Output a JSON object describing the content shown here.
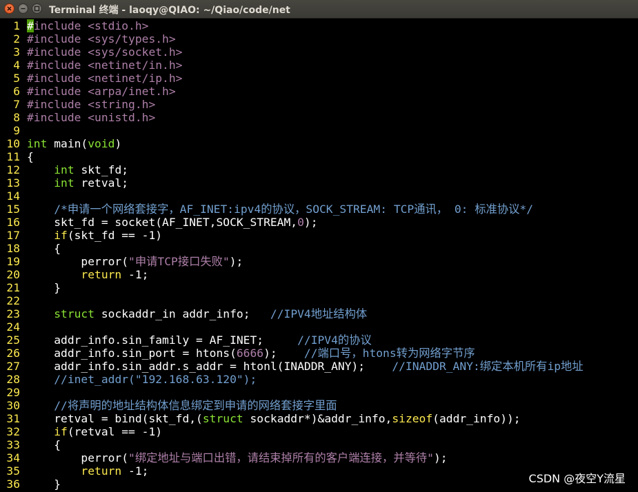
{
  "window": {
    "title": "Terminal 终端 - laoqy@QIAO: ~/Qiao/code/net"
  },
  "colors": {
    "background": "#000000",
    "line_number": "#fce94f",
    "preprocessor": "#ad7fa8",
    "type": "#8ae234",
    "string": "#ad7fa8",
    "comment": "#729fcf",
    "keyword": "#fce94f",
    "text": "#ffffff",
    "cursor": "#4e9a06"
  },
  "editor": {
    "lines": [
      {
        "num": "1",
        "tokens": [
          {
            "t": "#",
            "c": "cur"
          },
          {
            "t": "include ",
            "c": "pp"
          },
          {
            "t": "<stdio.h>",
            "c": "st"
          }
        ]
      },
      {
        "num": "2",
        "tokens": [
          {
            "t": "#include ",
            "c": "pp"
          },
          {
            "t": "<sys/types.h>",
            "c": "st"
          }
        ]
      },
      {
        "num": "3",
        "tokens": [
          {
            "t": "#include ",
            "c": "pp"
          },
          {
            "t": "<sys/socket.h>",
            "c": "st"
          }
        ]
      },
      {
        "num": "4",
        "tokens": [
          {
            "t": "#include ",
            "c": "pp"
          },
          {
            "t": "<netinet/in.h>",
            "c": "st"
          }
        ]
      },
      {
        "num": "5",
        "tokens": [
          {
            "t": "#include ",
            "c": "pp"
          },
          {
            "t": "<netinet/ip.h>",
            "c": "st"
          }
        ]
      },
      {
        "num": "6",
        "tokens": [
          {
            "t": "#include ",
            "c": "pp"
          },
          {
            "t": "<arpa/inet.h>",
            "c": "st"
          }
        ]
      },
      {
        "num": "7",
        "tokens": [
          {
            "t": "#include ",
            "c": "pp"
          },
          {
            "t": "<string.h>",
            "c": "st"
          }
        ]
      },
      {
        "num": "8",
        "tokens": [
          {
            "t": "#include ",
            "c": "pp"
          },
          {
            "t": "<unistd.h>",
            "c": "st"
          }
        ]
      },
      {
        "num": "9",
        "tokens": []
      },
      {
        "num": "10",
        "tokens": [
          {
            "t": "int",
            "c": "ty"
          },
          {
            "t": " main(",
            "c": "tx"
          },
          {
            "t": "void",
            "c": "ty"
          },
          {
            "t": ")",
            "c": "tx"
          }
        ]
      },
      {
        "num": "11",
        "tokens": [
          {
            "t": "{",
            "c": "tx"
          }
        ]
      },
      {
        "num": "12",
        "tokens": [
          {
            "t": "    ",
            "c": "tx"
          },
          {
            "t": "int",
            "c": "ty"
          },
          {
            "t": " skt_fd;",
            "c": "tx"
          }
        ]
      },
      {
        "num": "13",
        "tokens": [
          {
            "t": "    ",
            "c": "tx"
          },
          {
            "t": "int",
            "c": "ty"
          },
          {
            "t": " retval;",
            "c": "tx"
          }
        ]
      },
      {
        "num": "14",
        "tokens": []
      },
      {
        "num": "15",
        "tokens": [
          {
            "t": "    ",
            "c": "tx"
          },
          {
            "t": "/*申请一个网络套接字，AF_INET:ipv4的协议，SOCK_STREAM: TCP通讯， 0: 标准协议*/",
            "c": "cm"
          }
        ]
      },
      {
        "num": "16",
        "tokens": [
          {
            "t": "    skt_fd = socket(AF_INET,SOCK_STREAM,",
            "c": "tx"
          },
          {
            "t": "0",
            "c": "nm"
          },
          {
            "t": ");",
            "c": "tx"
          }
        ]
      },
      {
        "num": "17",
        "tokens": [
          {
            "t": "    ",
            "c": "tx"
          },
          {
            "t": "if",
            "c": "kw"
          },
          {
            "t": "(skt_fd == -1)",
            "c": "tx"
          }
        ]
      },
      {
        "num": "18",
        "tokens": [
          {
            "t": "    {",
            "c": "tx"
          }
        ]
      },
      {
        "num": "19",
        "tokens": [
          {
            "t": "        perror(",
            "c": "tx"
          },
          {
            "t": "\"申请TCP接口失败\"",
            "c": "st"
          },
          {
            "t": ");",
            "c": "tx"
          }
        ]
      },
      {
        "num": "20",
        "tokens": [
          {
            "t": "        ",
            "c": "tx"
          },
          {
            "t": "return",
            "c": "kw"
          },
          {
            "t": " -1;",
            "c": "tx"
          }
        ]
      },
      {
        "num": "21",
        "tokens": [
          {
            "t": "    }",
            "c": "tx"
          }
        ]
      },
      {
        "num": "22",
        "tokens": []
      },
      {
        "num": "23",
        "tokens": [
          {
            "t": "    ",
            "c": "tx"
          },
          {
            "t": "struct",
            "c": "ty"
          },
          {
            "t": " sockaddr_in addr_info;   ",
            "c": "tx"
          },
          {
            "t": "//IPV4地址结构体",
            "c": "cm"
          }
        ]
      },
      {
        "num": "24",
        "tokens": []
      },
      {
        "num": "25",
        "tokens": [
          {
            "t": "    addr_info.sin_family = AF_INET;     ",
            "c": "tx"
          },
          {
            "t": "//IPV4的协议",
            "c": "cm"
          }
        ]
      },
      {
        "num": "26",
        "tokens": [
          {
            "t": "    addr_info.sin_port = htons(",
            "c": "tx"
          },
          {
            "t": "6666",
            "c": "nm"
          },
          {
            "t": ");    ",
            "c": "tx"
          },
          {
            "t": "//端口号，htons转为网络字节序",
            "c": "cm"
          }
        ]
      },
      {
        "num": "27",
        "tokens": [
          {
            "t": "    addr_info.sin_addr.s_addr = htonl(INADDR_ANY);    ",
            "c": "tx"
          },
          {
            "t": "//INADDR_ANY:绑定本机所有ip地址",
            "c": "cm"
          }
        ]
      },
      {
        "num": "28",
        "tokens": [
          {
            "t": "    ",
            "c": "tx"
          },
          {
            "t": "//inet_addr(\"192.168.63.120\");",
            "c": "cm"
          }
        ]
      },
      {
        "num": "29",
        "tokens": []
      },
      {
        "num": "30",
        "tokens": [
          {
            "t": "    ",
            "c": "tx"
          },
          {
            "t": "//将声明的地址结构体信息绑定到申请的网络套接字里面",
            "c": "cm"
          }
        ]
      },
      {
        "num": "31",
        "tokens": [
          {
            "t": "    retval = bind(skt_fd,(",
            "c": "tx"
          },
          {
            "t": "struct",
            "c": "ty"
          },
          {
            "t": " sockaddr*)&addr_info,",
            "c": "tx"
          },
          {
            "t": "sizeof",
            "c": "kw"
          },
          {
            "t": "(addr_info));",
            "c": "tx"
          }
        ]
      },
      {
        "num": "32",
        "tokens": [
          {
            "t": "    ",
            "c": "tx"
          },
          {
            "t": "if",
            "c": "kw"
          },
          {
            "t": "(retval == -1)",
            "c": "tx"
          }
        ]
      },
      {
        "num": "33",
        "tokens": [
          {
            "t": "    {",
            "c": "tx"
          }
        ]
      },
      {
        "num": "34",
        "tokens": [
          {
            "t": "        perror(",
            "c": "tx"
          },
          {
            "t": "\"绑定地址与端口出错，请结束掉所有的客户端连接，并等待\"",
            "c": "st"
          },
          {
            "t": ");",
            "c": "tx"
          }
        ]
      },
      {
        "num": "35",
        "tokens": [
          {
            "t": "        ",
            "c": "tx"
          },
          {
            "t": "return",
            "c": "kw"
          },
          {
            "t": " -1;",
            "c": "tx"
          }
        ]
      },
      {
        "num": "36",
        "tokens": [
          {
            "t": "    }",
            "c": "tx"
          }
        ]
      }
    ]
  },
  "watermark": "CSDN @夜空Y流星"
}
